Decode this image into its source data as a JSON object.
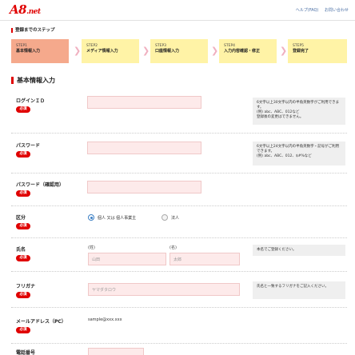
{
  "header": {
    "logo_main": "A8",
    "logo_sub": ".net",
    "links": [
      "ヘルプ(FAQ)",
      "お問い合わせ"
    ]
  },
  "steps_title": "登録までのステップ",
  "steps": [
    {
      "step": "STEP1",
      "label": "基本情報入力",
      "active": true
    },
    {
      "step": "STEP2",
      "label": "メディア情報入力",
      "active": false
    },
    {
      "step": "STEP3",
      "label": "口座情報入力",
      "active": false
    },
    {
      "step": "STEP4",
      "label": "入力内容確認・修正",
      "active": false
    },
    {
      "step": "STEP5",
      "label": "登録完了",
      "active": false
    }
  ],
  "section_title": "基本情報入力",
  "required_badge": "必須",
  "fields": {
    "login_id": {
      "label": "ログインＩＤ",
      "hint": "6文字以上30文字以内の半角英数字がご利用できます。\n(例) abc、ABC、012など\n登録後の変更はできません。"
    },
    "password": {
      "label": "パスワード",
      "hint": "6文字以上24文字以内の半角英数字・記号がご利用できます。\n(例) abc、ABC、012、$#%など"
    },
    "password_confirm": {
      "label": "パスワード（確認用）"
    },
    "category": {
      "label": "区分",
      "options": [
        "個人 又は 個人事業主",
        "法人"
      ],
      "selected": "個人 又は 個人事業主"
    },
    "name": {
      "label": "氏名",
      "last_label": "(姓)",
      "first_label": "(名)",
      "last_placeholder": "山田",
      "first_placeholder": "太郎",
      "hint": "本名でご登録ください。"
    },
    "furigana": {
      "label": "フリガナ",
      "placeholder": "ヤマダタロウ",
      "hint": "氏名と一致するフリガナをご記入ください。"
    },
    "email": {
      "label": "メールアドレス（PC）",
      "value": "sample@xxx.xxx"
    },
    "phone": {
      "label": "電話番号"
    }
  }
}
